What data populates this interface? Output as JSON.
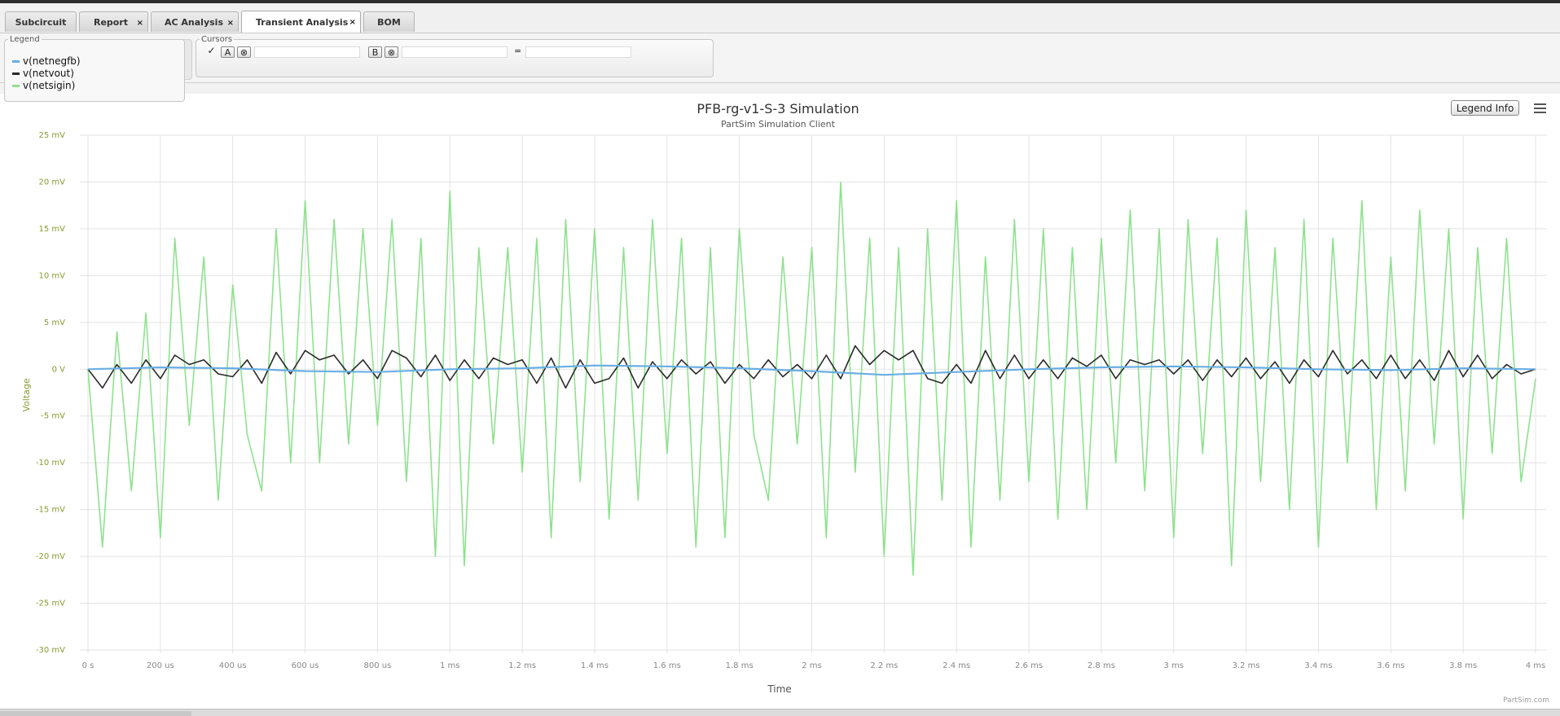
{
  "tabs": [
    {
      "label": "Subcircuit",
      "closable": false
    },
    {
      "label": "Report",
      "closable": true
    },
    {
      "label": "AC Analysis",
      "closable": true
    },
    {
      "label": "Transient Analysis",
      "closable": true,
      "active": true
    },
    {
      "label": "BOM",
      "closable": false
    }
  ],
  "close_glyph": "×",
  "legend_panel": {
    "title": "Legend",
    "items": [
      {
        "label": "v(netnegfb)",
        "color": "#6aaee3"
      },
      {
        "label": "v(netvout)",
        "color": "#2a2a2a"
      },
      {
        "label": "v(netsigin)",
        "color": "#8fe18f"
      }
    ]
  },
  "cursors_panel": {
    "title": "Cursors",
    "check": "✓",
    "a_label": "A",
    "b_label": "B",
    "clear_glyph": "⊗",
    "equals": "=",
    "a_value": "",
    "b_value": "",
    "diff_value": ""
  },
  "chart_controls": {
    "legend_info_label": "Legend Info",
    "menu_icon": "hamburger-menu-icon"
  },
  "chart_data": {
    "type": "line",
    "title": "PFB-rg-v1-S-3 Simulation",
    "subtitle": "PartSim Simulation Client",
    "xlabel": "Time",
    "ylabel": "Voltage",
    "credit": "PartSim.com",
    "x_unit": "ms",
    "xlim": [
      0,
      4
    ],
    "ylim": [
      -30,
      25
    ],
    "grid": true,
    "x_ticks": [
      {
        "v": 0,
        "label": "0 s"
      },
      {
        "v": 0.2,
        "label": "200 us"
      },
      {
        "v": 0.4,
        "label": "400 us"
      },
      {
        "v": 0.6,
        "label": "600 us"
      },
      {
        "v": 0.8,
        "label": "800 us"
      },
      {
        "v": 1.0,
        "label": "1 ms"
      },
      {
        "v": 1.2,
        "label": "1.2 ms"
      },
      {
        "v": 1.4,
        "label": "1.4 ms"
      },
      {
        "v": 1.6,
        "label": "1.6 ms"
      },
      {
        "v": 1.8,
        "label": "1.8 ms"
      },
      {
        "v": 2.0,
        "label": "2 ms"
      },
      {
        "v": 2.2,
        "label": "2.2 ms"
      },
      {
        "v": 2.4,
        "label": "2.4 ms"
      },
      {
        "v": 2.6,
        "label": "2.6 ms"
      },
      {
        "v": 2.8,
        "label": "2.8 ms"
      },
      {
        "v": 3.0,
        "label": "3 ms"
      },
      {
        "v": 3.2,
        "label": "3.2 ms"
      },
      {
        "v": 3.4,
        "label": "3.4 ms"
      },
      {
        "v": 3.6,
        "label": "3.6 ms"
      },
      {
        "v": 3.8,
        "label": "3.8 ms"
      },
      {
        "v": 4.0,
        "label": "4 ms"
      }
    ],
    "y_ticks": [
      {
        "v": 25,
        "label": "25 mV"
      },
      {
        "v": 20,
        "label": "20 mV"
      },
      {
        "v": 15,
        "label": "15 mV"
      },
      {
        "v": 10,
        "label": "10 mV"
      },
      {
        "v": 5,
        "label": "5 mV"
      },
      {
        "v": 0,
        "label": "0 V"
      },
      {
        "v": -5,
        "label": "-5 mV"
      },
      {
        "v": -10,
        "label": "-10 mV"
      },
      {
        "v": -15,
        "label": "-15 mV"
      },
      {
        "v": -20,
        "label": "-20 mV"
      },
      {
        "v": -25,
        "label": "-25 mV"
      },
      {
        "v": -30,
        "label": "-30 mV"
      }
    ],
    "axis_color": "#8a9a2e",
    "series": [
      {
        "name": "v(netsigin)",
        "color": "#8fe18f",
        "width": 1.6,
        "x": [
          0,
          0.04,
          0.08,
          0.12,
          0.16,
          0.2,
          0.24,
          0.28,
          0.32,
          0.36,
          0.4,
          0.44,
          0.48,
          0.52,
          0.56,
          0.6,
          0.64,
          0.68,
          0.72,
          0.76,
          0.8,
          0.84,
          0.88,
          0.92,
          0.96,
          1.0,
          1.04,
          1.08,
          1.12,
          1.16,
          1.2,
          1.24,
          1.28,
          1.32,
          1.36,
          1.4,
          1.44,
          1.48,
          1.52,
          1.56,
          1.6,
          1.64,
          1.68,
          1.72,
          1.76,
          1.8,
          1.84,
          1.88,
          1.92,
          1.96,
          2.0,
          2.04,
          2.08,
          2.12,
          2.16,
          2.2,
          2.24,
          2.28,
          2.32,
          2.36,
          2.4,
          2.44,
          2.48,
          2.52,
          2.56,
          2.6,
          2.64,
          2.68,
          2.72,
          2.76,
          2.8,
          2.84,
          2.88,
          2.92,
          2.96,
          3.0,
          3.04,
          3.08,
          3.12,
          3.16,
          3.2,
          3.24,
          3.28,
          3.32,
          3.36,
          3.4,
          3.44,
          3.48,
          3.52,
          3.56,
          3.6,
          3.64,
          3.68,
          3.72,
          3.76,
          3.8,
          3.84,
          3.88,
          3.92,
          3.96,
          4.0
        ],
        "y": [
          0,
          -19,
          4,
          -13,
          6,
          -18,
          14,
          -6,
          12,
          -14,
          9,
          -7,
          -13,
          15,
          -10,
          18,
          -10,
          16,
          -8,
          15,
          -6,
          16,
          -12,
          14,
          -20,
          19,
          -21,
          13,
          -8,
          13,
          -11,
          14,
          -18,
          16,
          -12,
          15,
          -16,
          13,
          -14,
          16,
          -9,
          14,
          -19,
          13,
          -18,
          15,
          -7,
          -14,
          12,
          -8,
          13,
          -18,
          20,
          -11,
          14,
          -20,
          13,
          -22,
          15,
          -14,
          18,
          -19,
          12,
          -14,
          16,
          -12,
          15,
          -16,
          13,
          -15,
          14,
          -10,
          17,
          -13,
          15,
          -18,
          16,
          -9,
          14,
          -21,
          17,
          -12,
          13,
          -15,
          16,
          -19,
          14,
          -10,
          18,
          -15,
          12,
          -13,
          17,
          -8,
          15,
          -16,
          13,
          -9,
          14,
          -12,
          -1
        ]
      },
      {
        "name": "v(netvout)",
        "color": "#2a2a2a",
        "width": 1.6,
        "x": [
          0,
          0.04,
          0.08,
          0.12,
          0.16,
          0.2,
          0.24,
          0.28,
          0.32,
          0.36,
          0.4,
          0.44,
          0.48,
          0.52,
          0.56,
          0.6,
          0.64,
          0.68,
          0.72,
          0.76,
          0.8,
          0.84,
          0.88,
          0.92,
          0.96,
          1.0,
          1.04,
          1.08,
          1.12,
          1.16,
          1.2,
          1.24,
          1.28,
          1.32,
          1.36,
          1.4,
          1.44,
          1.48,
          1.52,
          1.56,
          1.6,
          1.64,
          1.68,
          1.72,
          1.76,
          1.8,
          1.84,
          1.88,
          1.92,
          1.96,
          2.0,
          2.04,
          2.08,
          2.12,
          2.16,
          2.2,
          2.24,
          2.28,
          2.32,
          2.36,
          2.4,
          2.44,
          2.48,
          2.52,
          2.56,
          2.6,
          2.64,
          2.68,
          2.72,
          2.76,
          2.8,
          2.84,
          2.88,
          2.92,
          2.96,
          3.0,
          3.04,
          3.08,
          3.12,
          3.16,
          3.2,
          3.24,
          3.28,
          3.32,
          3.36,
          3.4,
          3.44,
          3.48,
          3.52,
          3.56,
          3.6,
          3.64,
          3.68,
          3.72,
          3.76,
          3.8,
          3.84,
          3.88,
          3.92,
          3.96,
          4.0
        ],
        "y": [
          0,
          -2,
          0.5,
          -1.5,
          1,
          -1,
          1.5,
          0.5,
          1,
          -0.5,
          -0.8,
          1,
          -1.5,
          1.8,
          -0.5,
          2,
          1,
          1.5,
          -0.5,
          1,
          -1,
          2,
          1.2,
          -0.8,
          1.5,
          -1.2,
          1,
          -1,
          1.2,
          0.5,
          1,
          -1.5,
          1.2,
          -2,
          1,
          -1.5,
          -1,
          1.2,
          -2,
          0.8,
          -1,
          1,
          -0.5,
          0.8,
          -1.5,
          0.5,
          -1,
          1,
          -0.8,
          0.5,
          -1,
          1.5,
          -1,
          2.5,
          0.5,
          2,
          1,
          2,
          -1,
          -1.5,
          0.5,
          -1.5,
          2,
          -1,
          1.5,
          -1,
          1,
          -1,
          1.2,
          0.3,
          1.5,
          -1,
          1,
          0.5,
          1,
          -0.5,
          1,
          -1.2,
          1,
          -0.8,
          1.2,
          -1,
          0.8,
          -1.5,
          1,
          -0.8,
          2,
          -0.5,
          1,
          -1,
          1.5,
          -1,
          1,
          -1.2,
          2,
          -0.8,
          1.5,
          -1,
          0.5,
          -0.5,
          0
        ]
      },
      {
        "name": "v(netnegfb)",
        "color": "#6aaee3",
        "width": 2.2,
        "x": [
          0,
          0.2,
          0.4,
          0.6,
          0.8,
          1.0,
          1.2,
          1.4,
          1.6,
          1.8,
          2.0,
          2.2,
          2.4,
          2.6,
          2.8,
          3.0,
          3.2,
          3.4,
          3.6,
          3.8,
          4.0
        ],
        "y": [
          0,
          0.2,
          0.1,
          -0.2,
          -0.3,
          0,
          0.1,
          0.4,
          0.3,
          0.1,
          -0.2,
          -0.6,
          -0.3,
          0,
          0.2,
          0.3,
          0.2,
          0,
          -0.1,
          0.1,
          0
        ]
      }
    ]
  }
}
